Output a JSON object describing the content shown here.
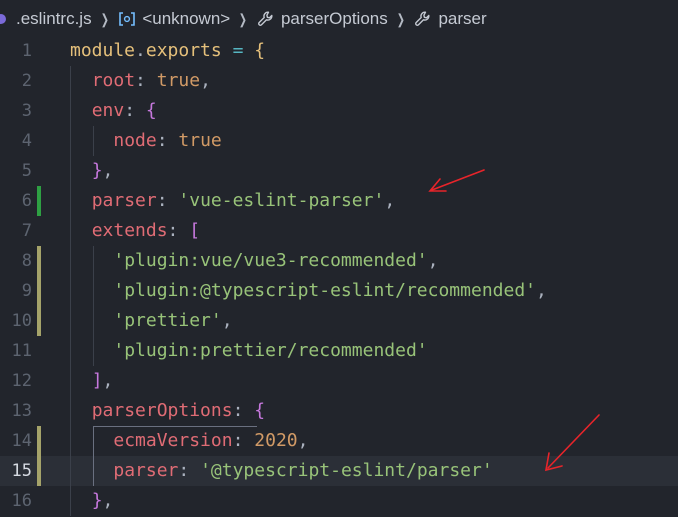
{
  "breadcrumb": {
    "items": [
      {
        "label": ".eslintrc.js",
        "icon": "js-file-icon"
      },
      {
        "label": "<unknown>",
        "icon": "symbol-object-icon"
      },
      {
        "label": "parserOptions",
        "icon": "wrench-icon"
      },
      {
        "label": "parser",
        "icon": "wrench-icon"
      }
    ]
  },
  "editor": {
    "current_line": 15,
    "lines": [
      {
        "n": "1",
        "tokens": [
          {
            "t": "module",
            "c": "obj"
          },
          {
            "t": ".",
            "c": "pun"
          },
          {
            "t": "exports",
            "c": "obj"
          },
          {
            "t": " ",
            "c": "pun"
          },
          {
            "t": "=",
            "c": "op"
          },
          {
            "t": " ",
            "c": "pun"
          },
          {
            "t": "{",
            "c": "brace"
          }
        ]
      },
      {
        "n": "2",
        "tokens": [
          {
            "t": "  "
          },
          {
            "t": "root",
            "c": "prop"
          },
          {
            "t": ": ",
            "c": "pun"
          },
          {
            "t": "true",
            "c": "bool"
          },
          {
            "t": ",",
            "c": "pun"
          }
        ]
      },
      {
        "n": "3",
        "tokens": [
          {
            "t": "  "
          },
          {
            "t": "env",
            "c": "prop"
          },
          {
            "t": ": ",
            "c": "pun"
          },
          {
            "t": "{",
            "c": "brace2"
          }
        ]
      },
      {
        "n": "4",
        "tokens": [
          {
            "t": "    "
          },
          {
            "t": "node",
            "c": "prop"
          },
          {
            "t": ": ",
            "c": "pun"
          },
          {
            "t": "true",
            "c": "bool"
          }
        ]
      },
      {
        "n": "5",
        "tokens": [
          {
            "t": "  "
          },
          {
            "t": "}",
            "c": "brace2"
          },
          {
            "t": ",",
            "c": "pun"
          }
        ]
      },
      {
        "n": "6",
        "git": "added",
        "tokens": [
          {
            "t": "  "
          },
          {
            "t": "parser",
            "c": "prop"
          },
          {
            "t": ": ",
            "c": "pun"
          },
          {
            "t": "'vue-eslint-parser'",
            "c": "str"
          },
          {
            "t": ",",
            "c": "pun"
          }
        ]
      },
      {
        "n": "7",
        "tokens": [
          {
            "t": "  "
          },
          {
            "t": "extends",
            "c": "prop"
          },
          {
            "t": ": ",
            "c": "pun"
          },
          {
            "t": "[",
            "c": "brace2"
          }
        ]
      },
      {
        "n": "8",
        "git": "modified",
        "tokens": [
          {
            "t": "    "
          },
          {
            "t": "'plugin:vue/vue3-recommended'",
            "c": "str"
          },
          {
            "t": ",",
            "c": "pun"
          }
        ]
      },
      {
        "n": "9",
        "git": "modified",
        "tokens": [
          {
            "t": "    "
          },
          {
            "t": "'plugin:@typescript-eslint/recommended'",
            "c": "str"
          },
          {
            "t": ",",
            "c": "pun"
          }
        ]
      },
      {
        "n": "10",
        "git": "modified",
        "tokens": [
          {
            "t": "    "
          },
          {
            "t": "'prettier'",
            "c": "str"
          },
          {
            "t": ",",
            "c": "pun"
          }
        ]
      },
      {
        "n": "11",
        "tokens": [
          {
            "t": "    "
          },
          {
            "t": "'plugin:prettier/recommended'",
            "c": "str"
          }
        ]
      },
      {
        "n": "12",
        "tokens": [
          {
            "t": "  "
          },
          {
            "t": "]",
            "c": "brace2"
          },
          {
            "t": ",",
            "c": "pun"
          }
        ]
      },
      {
        "n": "13",
        "tokens": [
          {
            "t": "  "
          },
          {
            "t": "parserOptions",
            "c": "prop"
          },
          {
            "t": ": ",
            "c": "pun"
          },
          {
            "t": "{",
            "c": "brace2"
          }
        ]
      },
      {
        "n": "14",
        "git": "modified",
        "tokens": [
          {
            "t": "    "
          },
          {
            "t": "ecmaVersion",
            "c": "prop"
          },
          {
            "t": ": ",
            "c": "pun"
          },
          {
            "t": "2020",
            "c": "num"
          },
          {
            "t": ",",
            "c": "pun"
          }
        ]
      },
      {
        "n": "15",
        "git": "modified",
        "tokens": [
          {
            "t": "    "
          },
          {
            "t": "parser",
            "c": "prop"
          },
          {
            "t": ": ",
            "c": "pun"
          },
          {
            "t": "'@typescript-eslint/parser'",
            "c": "str"
          }
        ]
      },
      {
        "n": "16",
        "tokens": [
          {
            "t": "  "
          },
          {
            "t": "}",
            "c": "brace2"
          },
          {
            "t": ",",
            "c": "pun"
          }
        ]
      }
    ]
  },
  "colors": {
    "background": "#22252c",
    "current_line": "#2b2f37",
    "git_added": "#2ea043",
    "git_modified": "#a5a36a",
    "annotation_arrow": "#e8242a"
  }
}
